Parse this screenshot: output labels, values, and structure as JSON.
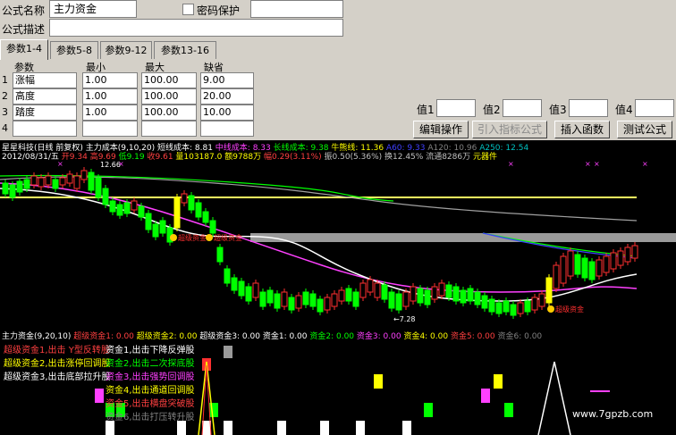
{
  "editor": {
    "name_label": "公式名称",
    "name_value": "主力资金",
    "password_label": "密码保护",
    "desc_label": "公式描述",
    "desc_value": "",
    "tabs": [
      "参数1-4",
      "参数5-8",
      "参数9-12",
      "参数13-16"
    ],
    "param_headers": [
      "参数",
      "最小",
      "最大",
      "缺省"
    ],
    "params": [
      {
        "index": "1",
        "name": "涨幅",
        "min": "1.00",
        "max": "100.00",
        "default": "9.00"
      },
      {
        "index": "2",
        "name": "高度",
        "min": "1.00",
        "max": "100.00",
        "default": "20.00"
      },
      {
        "index": "3",
        "name": "踏度",
        "min": "1.00",
        "max": "100.00",
        "default": "10.00"
      },
      {
        "index": "4",
        "name": "",
        "min": "",
        "max": "",
        "default": ""
      }
    ],
    "value_labels": [
      "值1",
      "值2",
      "值3",
      "值4"
    ],
    "buttons": {
      "edit": "编辑操作",
      "import": "引入指标公式",
      "insert": "插入函数",
      "test": "测试公式"
    }
  },
  "chart": {
    "title_line": "星星科技(日线 前复权) 主力成本(9,10,20)",
    "ma_items": [
      {
        "text": "短线成本: 8.81",
        "color": "#ffffff"
      },
      {
        "text": "中线成本: 8.33",
        "color": "#ff40ff"
      },
      {
        "text": "长线成本: 9.38",
        "color": "#00ff00"
      },
      {
        "text": "牛熊线: 11.36",
        "color": "#ffff00"
      },
      {
        "text": "A60: 9.33",
        "color": "#4040ff"
      },
      {
        "text": "A120: 10.96",
        "color": "#808080"
      },
      {
        "text": "A250: 12.54",
        "color": "#00c0c0"
      }
    ],
    "date": "2012/08/31/五",
    "quote_items": [
      {
        "text": "开9.34",
        "color": "#ff4040"
      },
      {
        "text": "高9.69",
        "color": "#ff4040"
      },
      {
        "text": "低9.19",
        "color": "#00ff00"
      },
      {
        "text": "收9.61",
        "color": "#ff4040"
      },
      {
        "text": "量103187.0",
        "color": "#ffff00"
      },
      {
        "text": "额9788万",
        "color": "#ffff00"
      },
      {
        "text": "幅0.29(3.11%)",
        "color": "#ff4040"
      },
      {
        "text": "振0.50(5.36%)",
        "color": "#c0c0c0"
      },
      {
        "text": "换12.45%",
        "color": "#c0c0c0"
      },
      {
        "text": "流通8286万",
        "color": "#c0c0c0"
      },
      {
        "text": "元器件",
        "color": "#ffff00"
      }
    ],
    "price_high_label": "12.66",
    "price_low_label": "7.28",
    "annotations": [
      "超级资金",
      "超级资金",
      "超级资金"
    ],
    "indicator_title": "主力资金(9,20,10)",
    "indicator_items": [
      {
        "text": "超级资金1: 0.00",
        "color": "#ff4040"
      },
      {
        "text": "超级资金2: 0.00",
        "color": "#ffff00"
      },
      {
        "text": "超级资金3: 0.00",
        "color": "#ffffff"
      },
      {
        "text": "资金1: 0.00",
        "color": "#ffffff"
      },
      {
        "text": "资金2: 0.00",
        "color": "#00ff00"
      },
      {
        "text": "资金3: 0.00",
        "color": "#ff40ff"
      },
      {
        "text": "资金4: 0.00",
        "color": "#ffff00"
      },
      {
        "text": "资金5: 0.00",
        "color": "#ff4040"
      },
      {
        "text": "资金6: 0.00",
        "color": "#808080"
      }
    ],
    "legend_left": [
      {
        "text": "超级资金1,出击 Y型反转股",
        "color": "#ff4040"
      },
      {
        "text": "超级资金2,出击涨停回调股",
        "color": "#ffff00"
      },
      {
        "text": "超级资金3,出击底部拉升股",
        "color": "#ffffff"
      }
    ],
    "legend_right": [
      {
        "text": "资金1,出击下降反弹股",
        "color": "#ffffff"
      },
      {
        "text": "资金2,出击二次探底股",
        "color": "#00ff00"
      },
      {
        "text": "资金3,出击强势回调股",
        "color": "#ff40ff"
      },
      {
        "text": "资金4,出击通道回调股",
        "color": "#ffff00"
      },
      {
        "text": "资金5,出击横盘突破股",
        "color": "#ff4040"
      },
      {
        "text": "资金6,出击打压转升股",
        "color": "#808080"
      }
    ],
    "watermark": "www.7gpzb.com"
  }
}
